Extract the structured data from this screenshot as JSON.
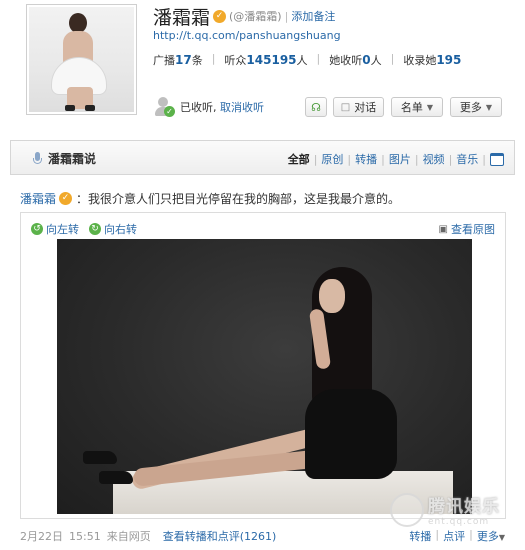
{
  "profile": {
    "name": "潘霜霜",
    "verified_badge": "✓",
    "handle": "(@潘霜霜)",
    "add_note": "添加备注",
    "url": "http://t.qq.com/panshuangshuang",
    "stats": {
      "broadcast_label": "广播",
      "broadcast_count": "17",
      "broadcast_unit": "条",
      "listeners_label": "听众",
      "listeners_count": "145195",
      "listeners_unit": "人",
      "listening_label": "她收听",
      "listening_count": "0",
      "listening_unit": "人",
      "collected_label": "收录她",
      "collected_count": "195"
    },
    "follow_status": "已收听",
    "unfollow_link": "取消收听",
    "buttons": {
      "listen_icon": "headphones-icon",
      "chat": "对话",
      "list": "名单",
      "more": "更多"
    }
  },
  "section": {
    "title": "潘霜霜说",
    "filters": [
      "全部",
      "原创",
      "转播",
      "图片",
      "视频",
      "音乐"
    ],
    "active_filter": "全部"
  },
  "post": {
    "author": "潘霜霜",
    "text": "：我很介意人们只把目光停留在我的胸部，这是我最介意的。",
    "rotate_left": "向左转",
    "rotate_right": "向右转",
    "view_original": "查看原图",
    "date": "2月22日",
    "time": "15:51",
    "source": "来自网页",
    "view_reposts": "查看转播和点评",
    "repost_count": "(1261)",
    "actions": {
      "repost": "转播",
      "comment": "点评",
      "more": "更多"
    }
  },
  "watermark": {
    "cn": "腾讯娱乐",
    "en": "ent.qq.com"
  },
  "colors": {
    "link": "#2b6aa8",
    "count": "#1a5fa0",
    "verify": "#f1a92b",
    "green": "#5bb24a"
  }
}
